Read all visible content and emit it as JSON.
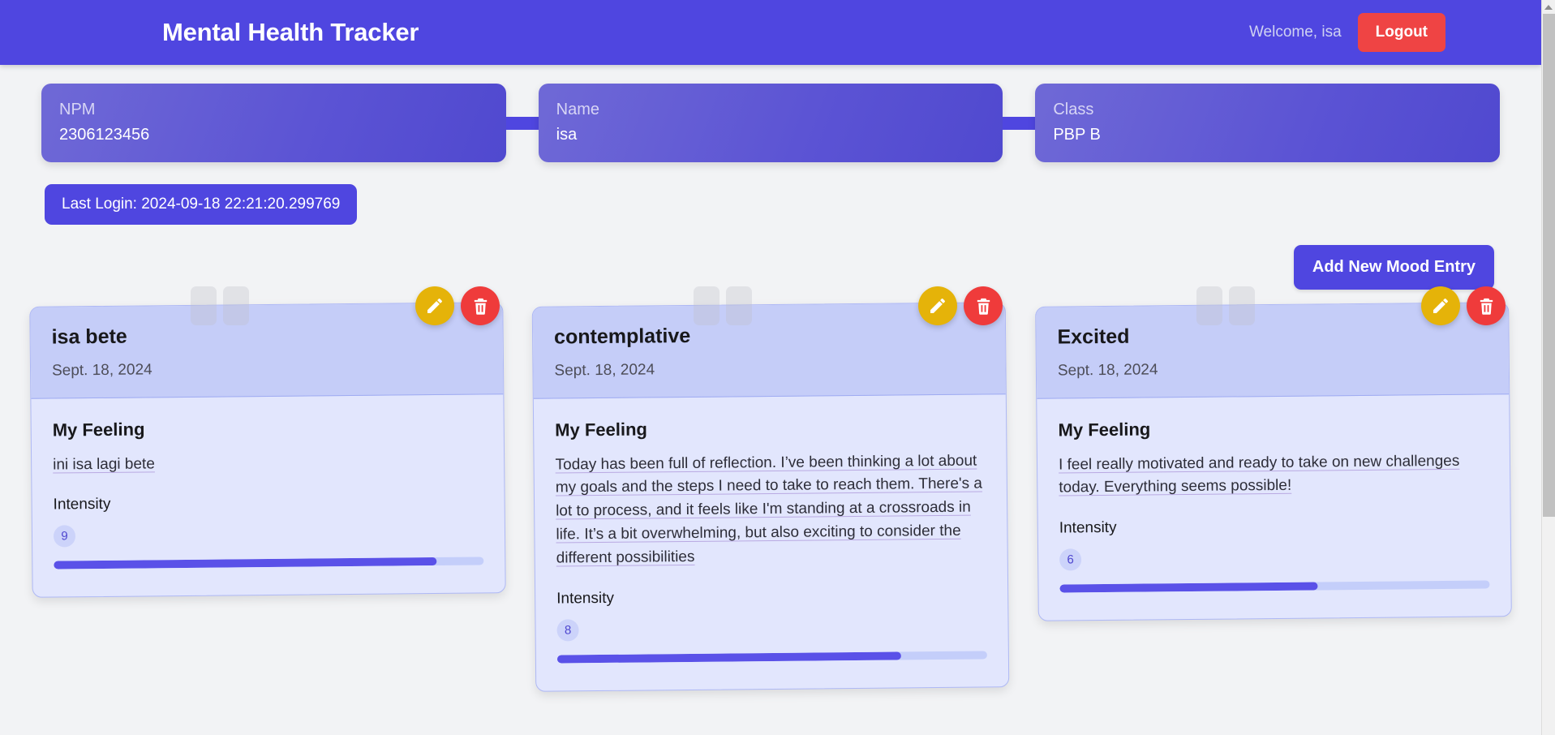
{
  "header": {
    "title": "Mental Health Tracker",
    "welcome": "Welcome, isa",
    "logout_label": "Logout",
    "background_color": "#4f46e0",
    "logout_color": "#ef4444"
  },
  "info_cards": [
    {
      "label": "NPM",
      "value": "2306123456"
    },
    {
      "label": "Name",
      "value": "isa"
    },
    {
      "label": "Class",
      "value": "PBP B"
    }
  ],
  "last_login": "Last Login: 2024-09-18 22:21:20.299769",
  "actions": {
    "add_entry_label": "Add New Mood Entry"
  },
  "labels": {
    "feeling_heading": "My Feeling",
    "intensity_heading": "Intensity",
    "edit_icon": "pencil-icon",
    "delete_icon": "trash-icon"
  },
  "mood_entries": [
    {
      "title": "isa bete",
      "date": "Sept. 18, 2024",
      "feeling": "ini isa lagi bete",
      "intensity": "9",
      "intensity_percent": "89%"
    },
    {
      "title": "contemplative",
      "date": "Sept. 18, 2024",
      "feeling": "Today has been full of reflection. I’ve been thinking a lot about my goals and the steps I need to take to reach them. There's a lot to process, and it feels like I'm standing at a crossroads in life. It’s a bit overwhelming, but also exciting to consider the different possibilities",
      "intensity": "8",
      "intensity_percent": "80%"
    },
    {
      "title": "Excited",
      "date": "Sept. 18, 2024",
      "feeling": "I feel really motivated and ready to take on new challenges today. Everything seems possible!",
      "intensity": "6",
      "intensity_percent": "60%"
    }
  ],
  "colors": {
    "accent": "#4f46e0",
    "card_header": "#c5cdf8",
    "card_body": "#e2e6fd",
    "edit_button": "#e5b309",
    "delete_button": "#ef3b3b",
    "page_background": "#f2f3f5"
  }
}
